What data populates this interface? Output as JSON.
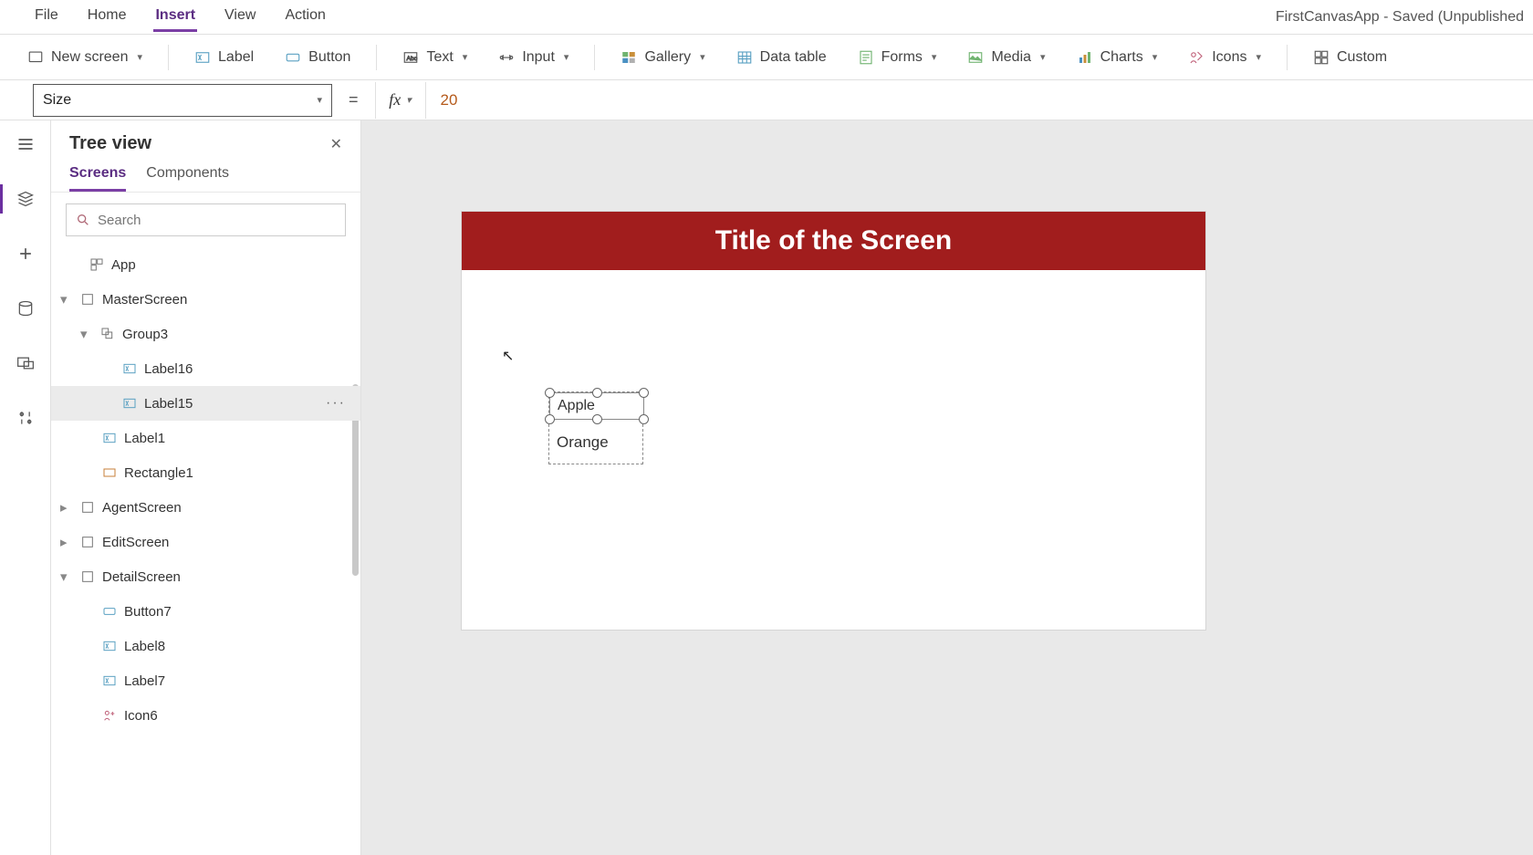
{
  "menu": {
    "items": [
      "File",
      "Home",
      "Insert",
      "View",
      "Action"
    ],
    "active_index": 2
  },
  "app_title": "FirstCanvasApp - Saved (Unpublished",
  "ribbon": {
    "new_screen": "New screen",
    "label": "Label",
    "button": "Button",
    "text": "Text",
    "input": "Input",
    "gallery": "Gallery",
    "data_table": "Data table",
    "forms": "Forms",
    "media": "Media",
    "charts": "Charts",
    "icons": "Icons",
    "custom": "Custom"
  },
  "formula": {
    "property": "Size",
    "value": "20"
  },
  "tree": {
    "title": "Tree view",
    "tabs": [
      "Screens",
      "Components"
    ],
    "active_tab": 0,
    "search_placeholder": "Search",
    "nodes": {
      "app": "App",
      "master": "MasterScreen",
      "group3": "Group3",
      "label16": "Label16",
      "label15": "Label15",
      "label1": "Label1",
      "rectangle1": "Rectangle1",
      "agent": "AgentScreen",
      "edit": "EditScreen",
      "detail": "DetailScreen",
      "button7": "Button7",
      "label8": "Label8",
      "label7": "Label7",
      "icon6": "Icon6"
    }
  },
  "canvas": {
    "title": "Title of the Screen",
    "label_apple": "Apple",
    "label_orange": "Orange"
  }
}
